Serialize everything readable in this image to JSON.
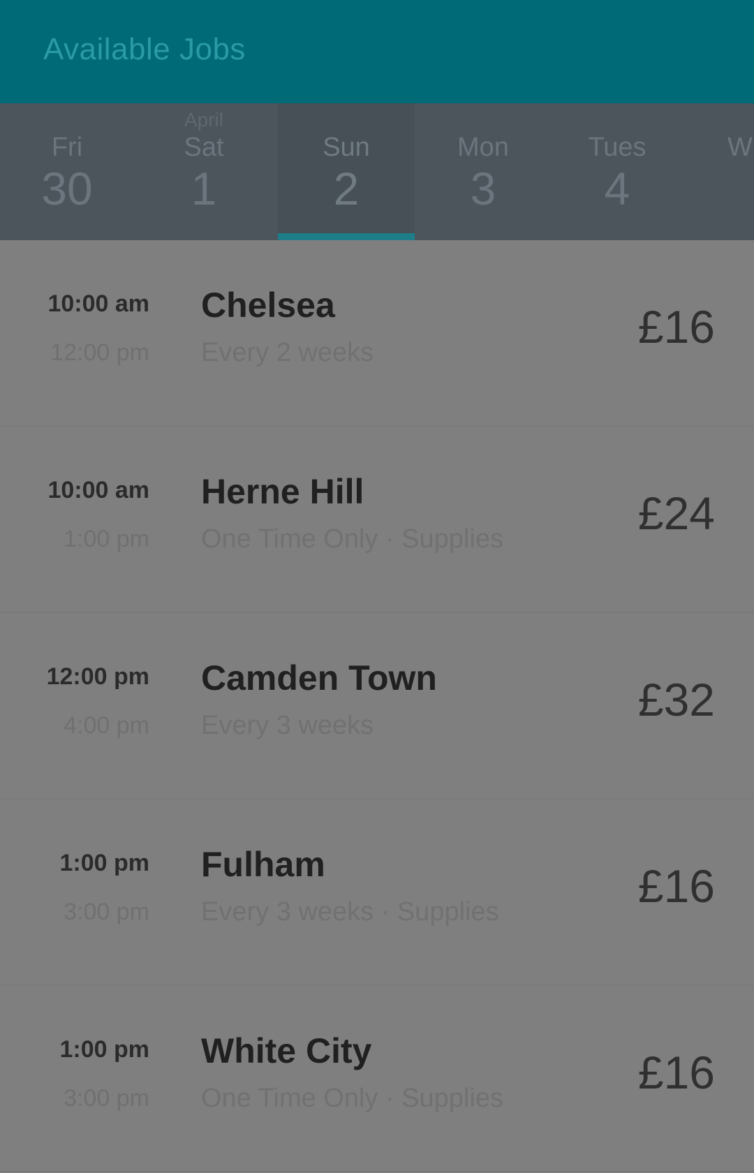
{
  "app_bar": {
    "title": "Available Jobs"
  },
  "date_strip": {
    "tabs": [
      {
        "month": "",
        "dow": "Fri",
        "day": "30",
        "selected": false
      },
      {
        "month": "April",
        "dow": "Sat",
        "day": "1",
        "selected": false
      },
      {
        "month": "",
        "dow": "Sun",
        "day": "2",
        "selected": true
      },
      {
        "month": "",
        "dow": "Mon",
        "day": "3",
        "selected": false
      },
      {
        "month": "",
        "dow": "Tues",
        "day": "4",
        "selected": false
      },
      {
        "month": "",
        "dow": "W",
        "day": "",
        "selected": false
      }
    ]
  },
  "jobs": [
    {
      "start": "10:00 am",
      "end": "12:00 pm",
      "location": "Chelsea",
      "details": "Every 2 weeks",
      "price": "£16"
    },
    {
      "start": "10:00 am",
      "end": "1:00 pm",
      "location": "Herne Hill",
      "details": "One Time Only · Supplies",
      "price": "£24"
    },
    {
      "start": "12:00 pm",
      "end": "4:00 pm",
      "location": "Camden Town",
      "details": "Every 3 weeks",
      "price": "£32"
    },
    {
      "start": "1:00 pm",
      "end": "3:00 pm",
      "location": "Fulham",
      "details": "Every 3 weeks · Supplies",
      "price": "£16"
    },
    {
      "start": "1:00 pm",
      "end": "3:00 pm",
      "location": "White City",
      "details": "One Time Only · Supplies",
      "price": "£16"
    }
  ],
  "colors": {
    "app_bar": "#006a76",
    "date_strip": "#4c545c",
    "selected_indicator": "#1e7d88",
    "list_background": "#7f7f7f"
  }
}
